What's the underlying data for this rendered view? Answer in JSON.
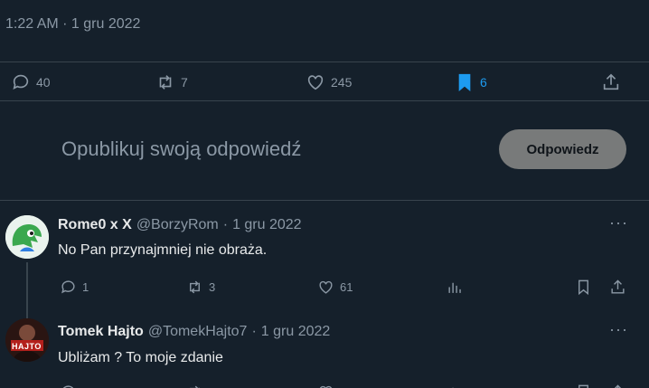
{
  "tweet_meta": {
    "timestamp": "1:22 AM · 1 gru 2022"
  },
  "actions": {
    "replies": "40",
    "retweets": "7",
    "likes": "245",
    "bookmarks": "6"
  },
  "composer": {
    "placeholder": "Opublikuj swoją odpowiedź",
    "reply_label": "Odpowiedz"
  },
  "replies": [
    {
      "name": "Rome0 x X",
      "handle": "@BorzyRom",
      "dot": "·",
      "date": "1 gru 2022",
      "text": "No Pan przynajmniej nie obraża.",
      "replies": "1",
      "retweets": "3",
      "likes": "61"
    },
    {
      "name": "Tomek Hajto",
      "handle": "@TomekHajto7",
      "dot": "·",
      "date": "1 gru 2022",
      "text": "Ubliżam ? To moje zdanie",
      "avatar_text": "HAJTO"
    }
  ],
  "more_label": "···",
  "colors": {
    "background": "#15202b",
    "accent": "#1d9bf0",
    "muted": "#8b98a5",
    "button": "#787a7a"
  }
}
